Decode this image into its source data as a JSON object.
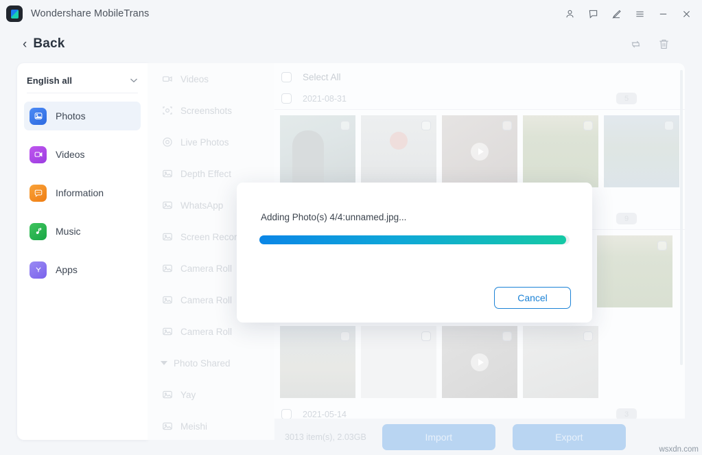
{
  "window": {
    "app_title": "Wondershare MobileTrans",
    "logo_icon": "mobiletrans-logo-icon",
    "controls": [
      {
        "name": "account-icon",
        "glyph": "person"
      },
      {
        "name": "feedback-icon",
        "glyph": "message"
      },
      {
        "name": "edit-icon",
        "glyph": "pen"
      },
      {
        "name": "menu-icon",
        "glyph": "hamburger"
      },
      {
        "name": "minimize-icon",
        "glyph": "minus"
      },
      {
        "name": "close-icon",
        "glyph": "x"
      }
    ]
  },
  "subheader": {
    "back_label": "Back",
    "back_chevron": "‹",
    "tools": [
      {
        "name": "refresh-icon",
        "glyph": "sync"
      },
      {
        "name": "delete-icon",
        "glyph": "trash"
      }
    ]
  },
  "sidebar": {
    "language_selector": {
      "label": "English all",
      "caret_icon": "chevron-down-icon"
    },
    "items": [
      {
        "label": "Photos",
        "icon": "photos-icon",
        "active": true
      },
      {
        "label": "Videos",
        "icon": "videos-icon",
        "active": false
      },
      {
        "label": "Information",
        "icon": "information-icon",
        "active": false
      },
      {
        "label": "Music",
        "icon": "music-icon",
        "active": false
      },
      {
        "label": "Apps",
        "icon": "apps-icon",
        "active": false
      }
    ]
  },
  "categories": [
    {
      "label": "Videos",
      "icon": "video-camera-icon",
      "type": "item"
    },
    {
      "label": "Screenshots",
      "icon": "screenshot-icon",
      "type": "item"
    },
    {
      "label": "Live Photos",
      "icon": "live-photo-icon",
      "type": "item"
    },
    {
      "label": "Depth Effect",
      "icon": "photo-icon",
      "type": "item"
    },
    {
      "label": "WhatsApp",
      "icon": "photo-icon",
      "type": "item"
    },
    {
      "label": "Screen Recorder",
      "icon": "photo-icon",
      "type": "item"
    },
    {
      "label": "Camera Roll",
      "icon": "photo-icon",
      "type": "item"
    },
    {
      "label": "Camera Roll",
      "icon": "photo-icon",
      "type": "item"
    },
    {
      "label": "Camera Roll",
      "icon": "photo-icon",
      "type": "item"
    },
    {
      "label": "Photo Shared",
      "icon": "triangle-down-icon",
      "type": "group"
    },
    {
      "label": "Yay",
      "icon": "photo-icon",
      "type": "item"
    },
    {
      "label": "Meishi",
      "icon": "photo-icon",
      "type": "item"
    }
  ],
  "content": {
    "select_all_label": "Select All",
    "groups": [
      {
        "date": "2021-08-31",
        "count": "5"
      },
      {
        "date": "",
        "count": "9"
      },
      {
        "date": "2021-05-14",
        "count": "3"
      }
    ],
    "rows": [
      [
        {
          "name": "thumb-person",
          "kind": "photo"
        },
        {
          "name": "thumb-flowers",
          "kind": "photo"
        },
        {
          "name": "thumb-video-hand",
          "kind": "video"
        },
        {
          "name": "thumb-hedge",
          "kind": "photo"
        },
        {
          "name": "thumb-palm-beach",
          "kind": "photo"
        }
      ],
      [
        {
          "name": "thumb-hedge-2",
          "kind": "photo"
        }
      ],
      [
        {
          "name": "thumb-totoro",
          "kind": "photo"
        },
        {
          "name": "thumb-infographic",
          "kind": "photo"
        },
        {
          "name": "thumb-video-room",
          "kind": "video"
        },
        {
          "name": "thumb-desk-cables",
          "kind": "photo"
        }
      ]
    ]
  },
  "bottom_bar": {
    "item_count": "3013 item(s), 2.03GB",
    "import_label": "Import",
    "export_label": "Export"
  },
  "dialog": {
    "message": "Adding Photo(s) 4/4:unnamed.jpg...",
    "progress_percent": 99,
    "progress_width": "99%",
    "cancel_label": "Cancel",
    "progress_start_color": "#0b86e6",
    "progress_end_color": "#15c9a5",
    "accent_color": "#1b82d6"
  },
  "watermark": "wsxdn.com"
}
